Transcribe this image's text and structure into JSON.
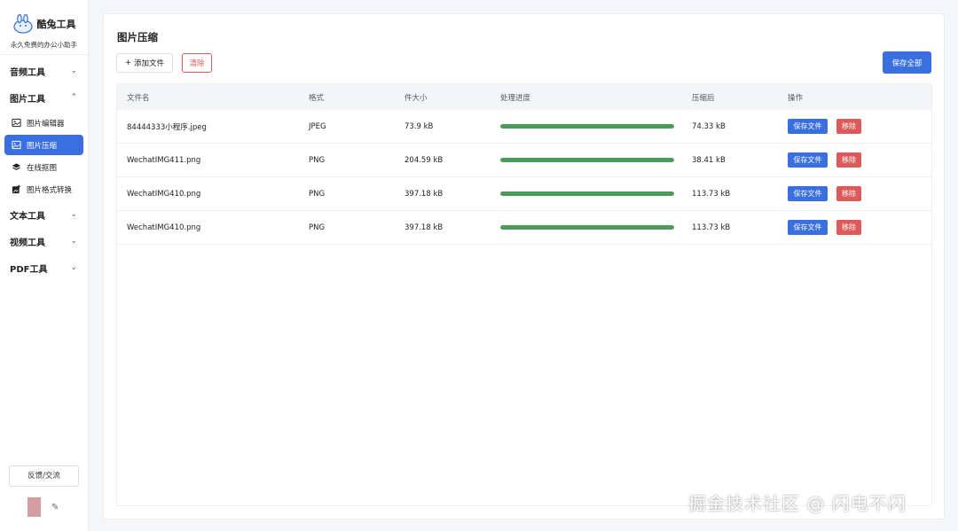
{
  "brand": {
    "name": "酷兔工具",
    "tagline": "永久免费的办公小助手"
  },
  "sidebar": {
    "groups": [
      {
        "label": "音频工具",
        "expanded": false
      },
      {
        "label": "图片工具",
        "expanded": true
      },
      {
        "label": "文本工具",
        "expanded": false
      },
      {
        "label": "视频工具",
        "expanded": false
      },
      {
        "label": "PDF工具",
        "expanded": false
      }
    ],
    "image_items": [
      {
        "label": "图片编辑器",
        "icon": "image-edit-icon",
        "active": false
      },
      {
        "label": "图片压缩",
        "icon": "image-icon",
        "active": true
      },
      {
        "label": "在线抠图",
        "icon": "layers-icon",
        "active": false
      },
      {
        "label": "图片格式转换",
        "icon": "image-convert-icon",
        "active": false
      }
    ],
    "feedback_label": "反馈/交流"
  },
  "main": {
    "title": "图片压缩",
    "add_label": "添加文件",
    "clear_label": "清除",
    "save_all_label": "保存全部"
  },
  "table": {
    "headers": [
      "文件名",
      "格式",
      "件大小",
      "处理进度",
      "压缩后",
      "操作"
    ],
    "rows": [
      {
        "name": "84444333小程序.jpeg",
        "format": "JPEG",
        "size": "73.9 kB",
        "progress": 1.0,
        "compressed": "74.33 kB",
        "save": "保存文件",
        "remove": "移除"
      },
      {
        "name": "WechatIMG411.png",
        "format": "PNG",
        "size": "204.59 kB",
        "progress": 1.0,
        "compressed": "38.41 kB",
        "save": "保存文件",
        "remove": "移除"
      },
      {
        "name": "WechatIMG410.png",
        "format": "PNG",
        "size": "397.18 kB",
        "progress": 1.0,
        "compressed": "113.73 kB",
        "save": "保存文件",
        "remove": "移除"
      },
      {
        "name": "WechatIMG410.png",
        "format": "PNG",
        "size": "397.18 kB",
        "progress": 1.0,
        "compressed": "113.73 kB",
        "save": "保存文件",
        "remove": "移除"
      }
    ]
  },
  "watermark": "掘金技术社区 @ 闪电不闪",
  "colors": {
    "primary": "#3a6fe0",
    "danger": "#dd5a5a",
    "progress": "#4b9c5a"
  }
}
